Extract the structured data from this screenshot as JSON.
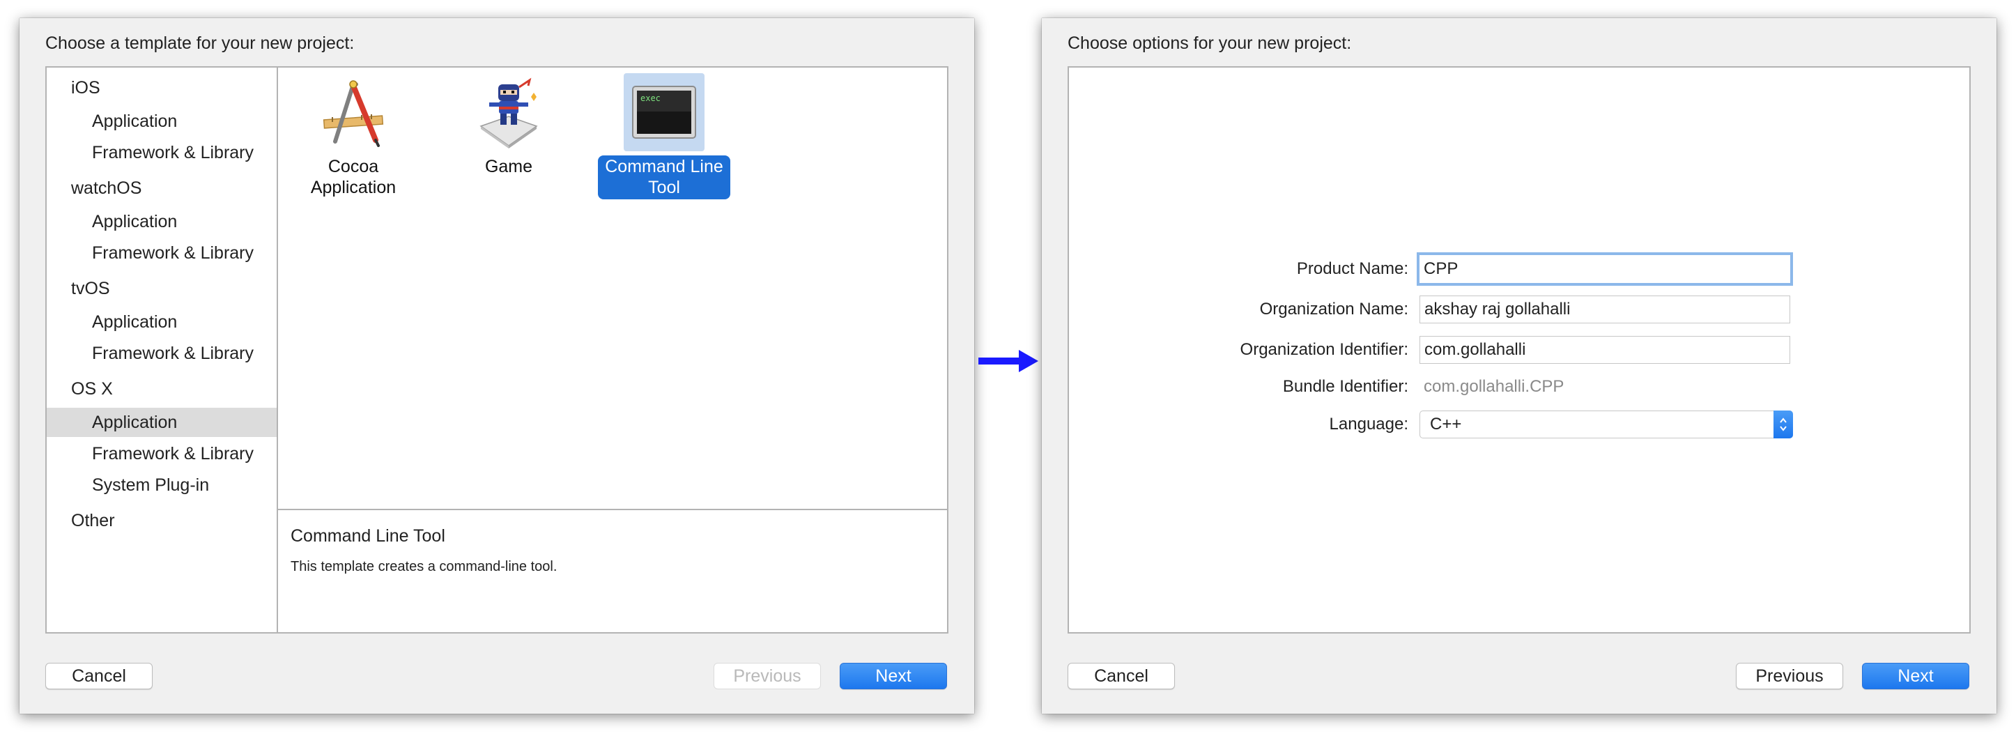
{
  "template_dialog": {
    "title": "Choose a template for your new project:",
    "sidebar": [
      {
        "kind": "section",
        "label": "iOS"
      },
      {
        "kind": "item",
        "label": "Application"
      },
      {
        "kind": "item",
        "label": "Framework & Library"
      },
      {
        "kind": "section",
        "label": "watchOS"
      },
      {
        "kind": "item",
        "label": "Application"
      },
      {
        "kind": "item",
        "label": "Framework & Library"
      },
      {
        "kind": "section",
        "label": "tvOS"
      },
      {
        "kind": "item",
        "label": "Application"
      },
      {
        "kind": "item",
        "label": "Framework & Library"
      },
      {
        "kind": "section",
        "label": "OS X"
      },
      {
        "kind": "item",
        "label": "Application",
        "selected": true
      },
      {
        "kind": "item",
        "label": "Framework & Library"
      },
      {
        "kind": "item",
        "label": "System Plug-in"
      },
      {
        "kind": "section",
        "label": "Other"
      }
    ],
    "templates": [
      {
        "label": "Cocoa\nApplication",
        "icon": "cocoa-app-icon"
      },
      {
        "label": "Game",
        "icon": "game-ninja-icon"
      },
      {
        "label": "Command Line\nTool",
        "icon": "terminal-exec-icon",
        "icon_text": "exec",
        "selected": true
      }
    ],
    "description": {
      "title": "Command Line Tool",
      "text": "This template creates a command-line tool."
    },
    "buttons": {
      "cancel": "Cancel",
      "previous": "Previous",
      "next": "Next"
    }
  },
  "options_dialog": {
    "title": "Choose options for your new project:",
    "fields": {
      "product_name_label": "Product Name:",
      "product_name_value": "CPP",
      "org_name_label": "Organization Name:",
      "org_name_value": "akshay raj gollahalli",
      "org_id_label": "Organization Identifier:",
      "org_id_value": "com.gollahalli",
      "bundle_id_label": "Bundle Identifier:",
      "bundle_id_value": "com.gollahalli.CPP",
      "language_label": "Language:",
      "language_value": "C++"
    },
    "buttons": {
      "cancel": "Cancel",
      "previous": "Previous",
      "next": "Next"
    }
  },
  "colors": {
    "accent": "#1d77ee",
    "selection": "#1d6fd6",
    "arrow": "#1a1aff"
  }
}
